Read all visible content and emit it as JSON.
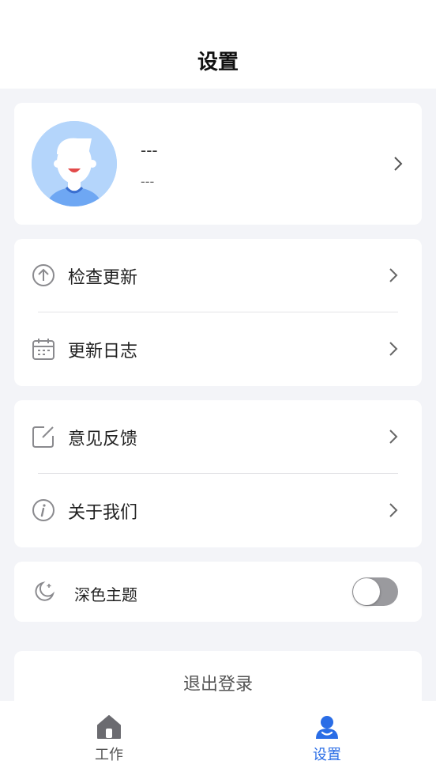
{
  "header": {
    "title": "设置"
  },
  "profile": {
    "name": "---",
    "subtitle": "---"
  },
  "group1": {
    "items": [
      {
        "label": "检查更新",
        "icon": "arrow-up-circle-icon"
      },
      {
        "label": "更新日志",
        "icon": "calendar-icon"
      }
    ]
  },
  "group2": {
    "items": [
      {
        "label": "意见反馈",
        "icon": "edit-square-icon"
      },
      {
        "label": "关于我们",
        "icon": "info-circle-icon"
      }
    ]
  },
  "theme": {
    "label": "深色主题",
    "icon": "moon-icon",
    "enabled": false
  },
  "logout": {
    "label": "退出登录"
  },
  "tabbar": {
    "tabs": [
      {
        "label": "工作",
        "icon": "home-icon",
        "active": false
      },
      {
        "label": "设置",
        "icon": "user-icon",
        "active": true
      }
    ]
  },
  "colors": {
    "accent": "#2a6de6",
    "background": "#f3f4f8",
    "toggle_off": "#9a9a9e"
  }
}
